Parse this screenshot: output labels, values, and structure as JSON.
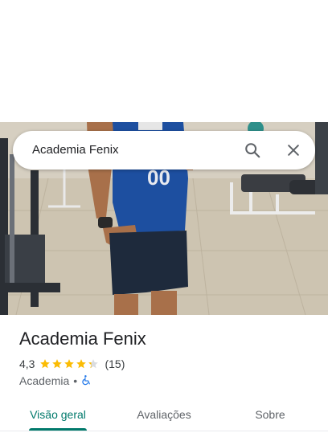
{
  "search": {
    "query": "Academia Fenix"
  },
  "place": {
    "name": "Academia Fenix",
    "rating": "4,3",
    "stars": 4.3,
    "review_count": "(15)",
    "category": "Academia",
    "separator": "•"
  },
  "tabs": [
    {
      "label": "Visão geral",
      "active": true
    },
    {
      "label": "Avaliações",
      "active": false
    },
    {
      "label": "Sobre",
      "active": false
    }
  ],
  "colors": {
    "accent": "#00796b",
    "star": "#fbbc04",
    "accessible": "#1a73e8"
  },
  "icons": {
    "search": "search-icon",
    "close": "close-icon",
    "accessibility": "wheelchair-icon"
  }
}
